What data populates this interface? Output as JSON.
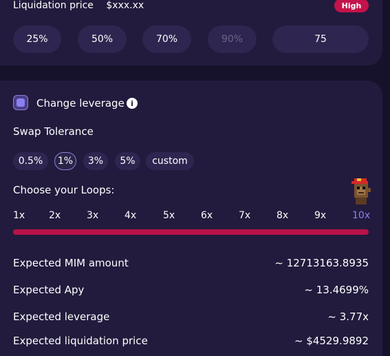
{
  "liquidation": {
    "label": "Liquidation price",
    "value": "$xxx.xx",
    "risk_badge": "High"
  },
  "percent_buttons": [
    {
      "label": "25%",
      "disabled": false
    },
    {
      "label": "50%",
      "disabled": false
    },
    {
      "label": "70%",
      "disabled": false
    },
    {
      "label": "90%",
      "disabled": true
    }
  ],
  "percent_input_value": "75",
  "change_leverage": {
    "label": "Change leverage",
    "checked": true,
    "info_icon": "info-icon"
  },
  "swap_tolerance": {
    "label": "Swap Tolerance",
    "options": [
      "0.5%",
      "1%",
      "3%",
      "5%",
      "custom"
    ],
    "selected": "1%"
  },
  "loops": {
    "label": "Choose your Loops:",
    "ticks": [
      "1x",
      "2x",
      "3x",
      "4x",
      "5x",
      "6x",
      "7x",
      "8x",
      "9x",
      "10x"
    ],
    "selected": "10x",
    "slider_fraction": 1.0
  },
  "expected": [
    {
      "label": "Expected MIM amount",
      "value": "~ 12713163.8935"
    },
    {
      "label": "Expected Apy",
      "value": "~ 13.4699%"
    },
    {
      "label": "Expected leverage",
      "value": "~ 3.77x"
    },
    {
      "label": "Expected liquidation price",
      "value": "~ $4529.9892"
    }
  ],
  "colors": {
    "accent": "#8b80f0",
    "danger": "#c4134b",
    "card": "#221b3d",
    "background": "#17122b",
    "button": "#2e2650"
  }
}
